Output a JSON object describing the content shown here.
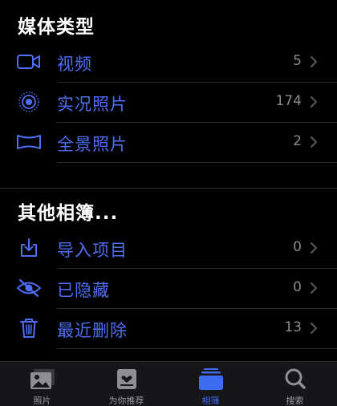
{
  "sections": {
    "media_types": {
      "title": "媒体类型",
      "items": [
        {
          "label": "视频",
          "count": "5"
        },
        {
          "label": "实况照片",
          "count": "174"
        },
        {
          "label": "全景照片",
          "count": "2"
        }
      ]
    },
    "other_albums": {
      "title": "其他相簿...",
      "items": [
        {
          "label": "导入项目",
          "count": "0"
        },
        {
          "label": "已隐藏",
          "count": "0"
        },
        {
          "label": "最近删除",
          "count": "13"
        }
      ]
    }
  },
  "tabbar": {
    "tabs": [
      {
        "label": "照片",
        "icon": "photo-icon"
      },
      {
        "label": "为你推荐",
        "icon": "for-you-icon"
      },
      {
        "label": "相簿",
        "icon": "albums-icon"
      },
      {
        "label": "搜索",
        "icon": "search-icon"
      }
    ],
    "active_index": 2
  },
  "colors": {
    "accent": "#4d6ef5",
    "background": "#000000",
    "count": "#8a8a8f",
    "tabbar_bg": "#161618"
  }
}
